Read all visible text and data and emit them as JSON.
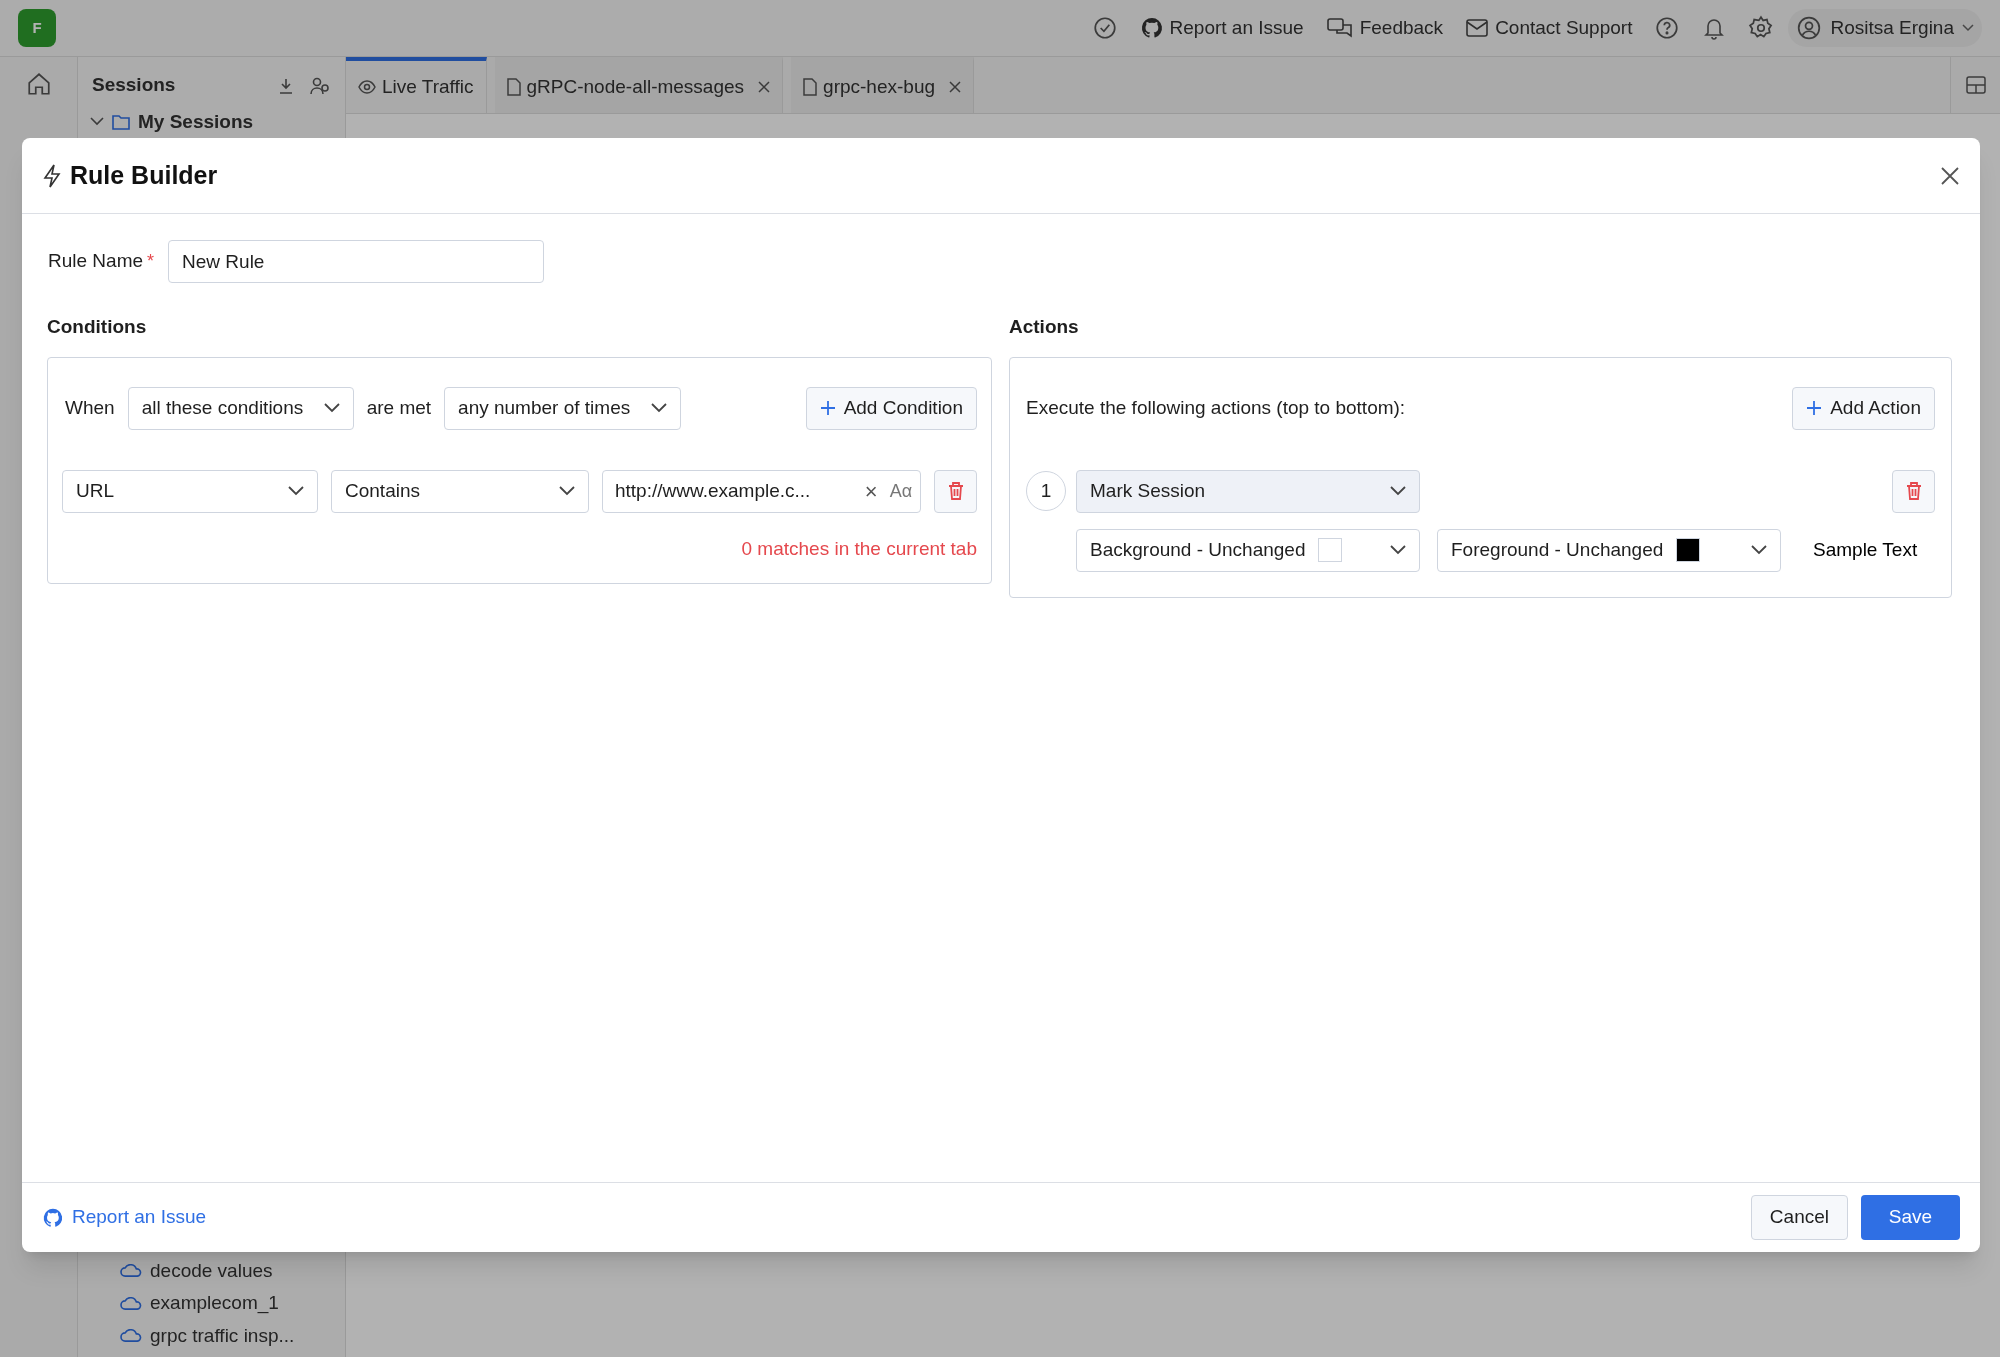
{
  "app": {
    "logo": "F",
    "top_bar": [
      {
        "kind": "check"
      },
      {
        "kind": "github",
        "label": "Report an Issue"
      },
      {
        "kind": "chat",
        "label": "Feedback"
      },
      {
        "kind": "mail",
        "label": "Contact Support"
      },
      {
        "kind": "help"
      },
      {
        "kind": "bell"
      },
      {
        "kind": "gear"
      },
      {
        "kind": "user",
        "label": "Rositsa Ergina"
      }
    ],
    "sidebar": {
      "title": "Sessions",
      "items": [
        {
          "label": "My Sessions",
          "kind": "folder"
        },
        {
          "label": "decode values",
          "kind": "cloud"
        },
        {
          "label": "examplecom_1",
          "kind": "cloud"
        },
        {
          "label": "grpc traffic insp...",
          "kind": "cloud"
        }
      ]
    },
    "tabs": [
      {
        "label": "Live Traffic",
        "kind": "live",
        "selected": true,
        "closable": false
      },
      {
        "label": "gRPC-node-all-messages",
        "kind": "file",
        "selected": false,
        "closable": true
      },
      {
        "label": "grpc-hex-bug",
        "kind": "file",
        "selected": false,
        "closable": true
      }
    ]
  },
  "dialog": {
    "title": "Rule Builder",
    "rule_name": {
      "label": "Rule Name",
      "required": true,
      "required_mark": "*",
      "value": "New Rule"
    },
    "conditions": {
      "title": "Conditions",
      "when_label": "When",
      "match_mode": "all these conditions",
      "are_met_label": "are met",
      "frequency": "any number of times",
      "add_button": "Add Condition",
      "rows": [
        {
          "field": "URL",
          "operator": "Contains",
          "value": "http://www.example.c...",
          "clear": "×",
          "case_toggle": "Aα"
        }
      ],
      "match_count": "0 matches in the current tab"
    },
    "actions": {
      "title": "Actions",
      "intro": "Execute the following actions (top to bottom):",
      "add_button": "Add Action",
      "items": [
        {
          "number": "1",
          "type": "Mark Session",
          "highlighted": true,
          "background": {
            "label": "Background - Unchanged",
            "color": "#ffffff"
          },
          "foreground": {
            "label": "Foreground - Unchanged",
            "color": "#000000"
          },
          "sample": "Sample Text"
        }
      ]
    },
    "footer": {
      "report_link": "Report an Issue",
      "cancel": "Cancel",
      "save": "Save"
    }
  }
}
